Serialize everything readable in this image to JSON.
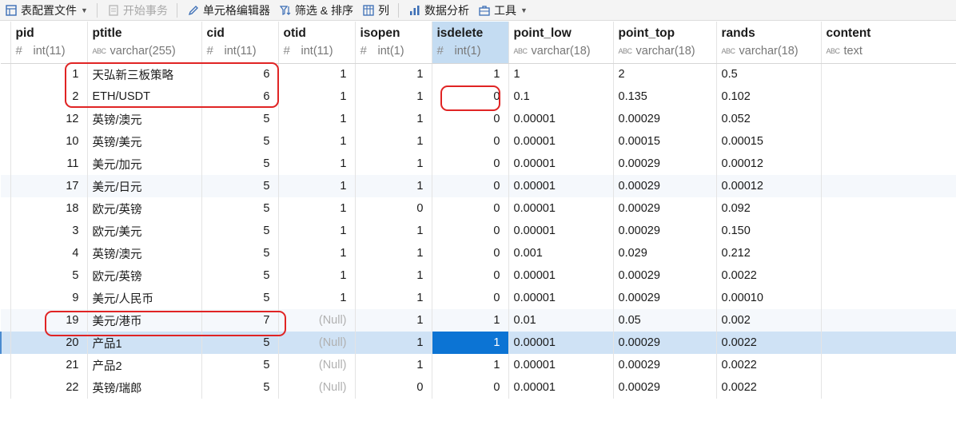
{
  "toolbar": {
    "table_config": "表配置文件",
    "begin_tx": "开始事务",
    "cell_editor": "单元格编辑器",
    "filter_sort": "筛选 & 排序",
    "columns": "列",
    "data_analysis": "数据分析",
    "tools": "工具"
  },
  "columns": [
    {
      "name": "pid",
      "type": "int(11)",
      "kind": "num"
    },
    {
      "name": "ptitle",
      "type": "varchar(255)",
      "kind": "text"
    },
    {
      "name": "cid",
      "type": "int(11)",
      "kind": "num"
    },
    {
      "name": "otid",
      "type": "int(11)",
      "kind": "num"
    },
    {
      "name": "isopen",
      "type": "int(1)",
      "kind": "num"
    },
    {
      "name": "isdelete",
      "type": "int(1)",
      "kind": "num"
    },
    {
      "name": "point_low",
      "type": "varchar(18)",
      "kind": "text"
    },
    {
      "name": "point_top",
      "type": "varchar(18)",
      "kind": "text"
    },
    {
      "name": "rands",
      "type": "varchar(18)",
      "kind": "text"
    },
    {
      "name": "content",
      "type": "text",
      "kind": "text"
    }
  ],
  "null_label": "(Null)",
  "rows": [
    [
      "1",
      "天弘新三板策略",
      "6",
      "1",
      "1",
      "1",
      "1",
      "2",
      "0.5",
      ""
    ],
    [
      "2",
      "ETH/USDT",
      "6",
      "1",
      "1",
      "0",
      "0.1",
      "0.135",
      "0.102",
      ""
    ],
    [
      "12",
      "英镑/澳元",
      "5",
      "1",
      "1",
      "0",
      "0.00001",
      "0.00029",
      "0.052",
      ""
    ],
    [
      "10",
      "英镑/美元",
      "5",
      "1",
      "1",
      "0",
      "0.00001",
      "0.00015",
      "0.00015",
      ""
    ],
    [
      "11",
      "美元/加元",
      "5",
      "1",
      "1",
      "0",
      "0.00001",
      "0.00029",
      "0.00012",
      ""
    ],
    [
      "17",
      "美元/日元",
      "5",
      "1",
      "1",
      "0",
      "0.00001",
      "0.00029",
      "0.00012",
      ""
    ],
    [
      "18",
      "欧元/英镑",
      "5",
      "1",
      "0",
      "0",
      "0.00001",
      "0.00029",
      "0.092",
      ""
    ],
    [
      "3",
      "欧元/美元",
      "5",
      "1",
      "1",
      "0",
      "0.00001",
      "0.00029",
      "0.150",
      ""
    ],
    [
      "4",
      "英镑/澳元",
      "5",
      "1",
      "1",
      "0",
      "0.001",
      "0.029",
      "0.212",
      ""
    ],
    [
      "5",
      "欧元/英镑",
      "5",
      "1",
      "1",
      "0",
      "0.00001",
      "0.00029",
      "0.0022",
      ""
    ],
    [
      "9",
      "美元/人民币",
      "5",
      "1",
      "1",
      "0",
      "0.00001",
      "0.00029",
      "0.00010",
      ""
    ],
    [
      "19",
      "美元/港币",
      "7",
      null,
      "1",
      "1",
      "0.01",
      "0.05",
      "0.002",
      ""
    ],
    [
      "20",
      "产品1",
      "5",
      null,
      "1",
      "1",
      "0.00001",
      "0.00029",
      "0.0022",
      ""
    ],
    [
      "21",
      "产品2",
      "5",
      null,
      "1",
      "1",
      "0.00001",
      "0.00029",
      "0.0022",
      ""
    ],
    [
      "22",
      "英镑/瑞郎",
      "5",
      null,
      "0",
      "0",
      "0.00001",
      "0.00029",
      "0.0022",
      ""
    ]
  ],
  "selected_column": 5,
  "selected_row": 12,
  "alt_rows": [
    5,
    11
  ],
  "colors": {
    "highlight": "#e02424",
    "selection": "#0c74d4",
    "selected_row": "#cfe2f5",
    "selected_header": "#c4dcf2"
  }
}
